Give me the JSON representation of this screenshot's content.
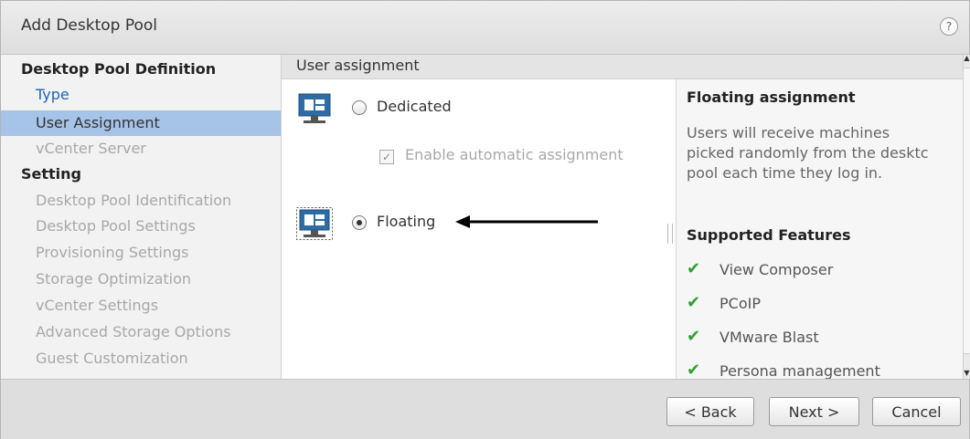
{
  "dialog": {
    "title": "Add Desktop Pool",
    "help_label": "?"
  },
  "sidebar": {
    "section1": "Desktop Pool Definition",
    "items1": [
      "Type",
      "User Assignment",
      "vCenter Server"
    ],
    "section2": "Setting",
    "items2": [
      "Desktop Pool Identification",
      "Desktop Pool Settings",
      "Provisioning Settings",
      "Storage Optimization",
      "vCenter Settings",
      "Advanced Storage Options",
      "Guest Customization"
    ]
  },
  "main": {
    "header": "User assignment",
    "dedicated_label": "Dedicated",
    "auto_assign_label": "Enable automatic assignment",
    "auto_assign_checked": true,
    "floating_label": "Floating",
    "selected": "Floating"
  },
  "info": {
    "title": "Floating assignment",
    "description_lines": [
      "Users will receive machines",
      "picked randomly from the desktc",
      "pool each time they log in."
    ],
    "features_title": "Supported Features",
    "features": [
      "View Composer",
      "PCoIP",
      "VMware Blast",
      "Persona management"
    ]
  },
  "footer": {
    "back": "< Back",
    "next": "Next >",
    "cancel": "Cancel"
  },
  "colors": {
    "selected_bg": "#a6c3e8",
    "link": "#1f63b5",
    "check": "#2fa12f",
    "icon_blue": "#2e6da4"
  }
}
